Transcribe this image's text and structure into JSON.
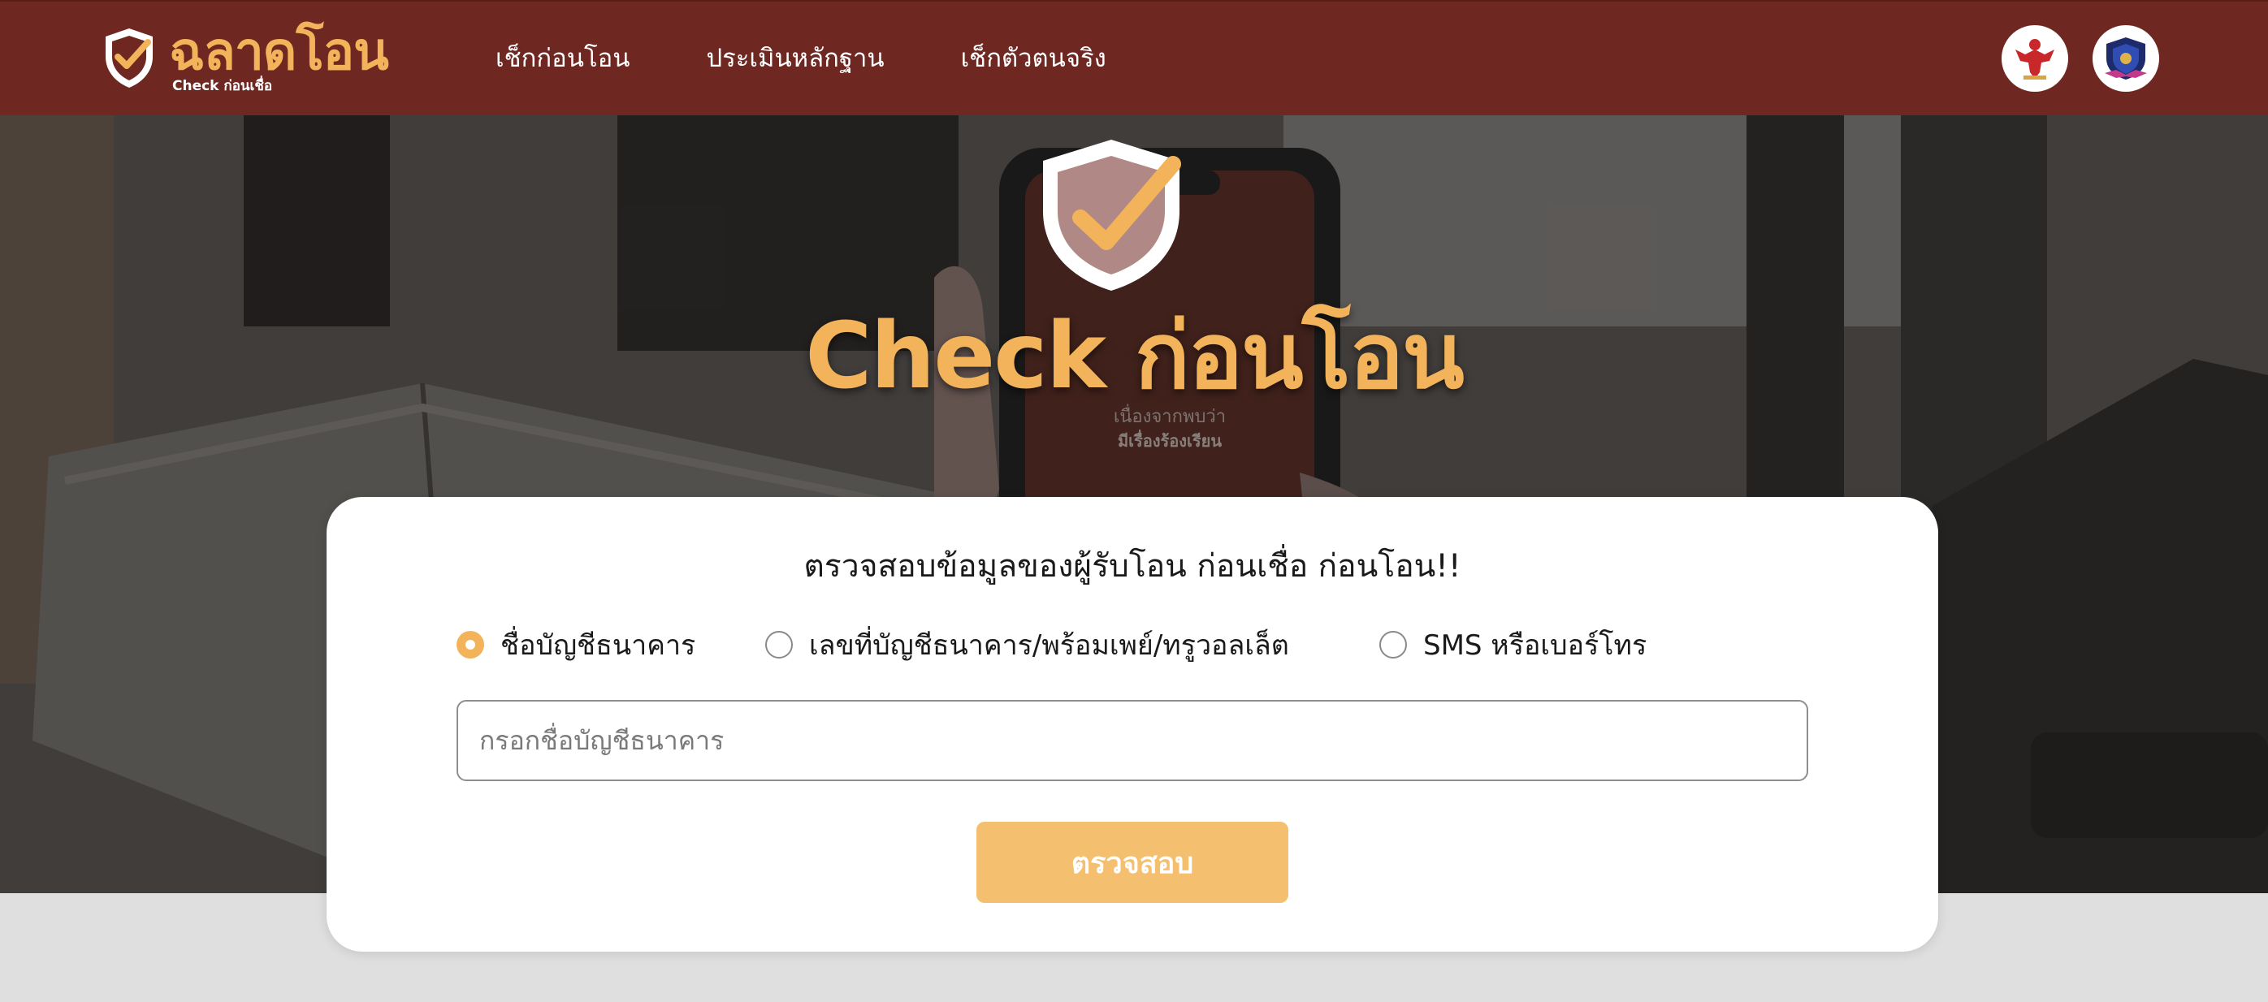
{
  "header": {
    "logo": {
      "title": "ฉลาดโอน",
      "subtitle": "Check ก่อนเชื่อ",
      "icon": "shield-check-icon"
    },
    "nav": [
      {
        "label": "เช็กก่อนโอน"
      },
      {
        "label": "ประเมินหลักฐาน"
      },
      {
        "label": "เช็กตัวตนจริง"
      }
    ],
    "badges": [
      {
        "icon": "garuda-emblem-icon"
      },
      {
        "icon": "police-emblem-icon"
      }
    ]
  },
  "hero": {
    "title": "Check ก่อนโอน",
    "icon": "shield-check-icon"
  },
  "form": {
    "heading": "ตรวจสอบข้อมูลของผู้รับโอน ก่อนเชื่อ ก่อนโอน!!",
    "options": [
      {
        "label": "ชื่อบัญชีธนาคาร",
        "checked": true
      },
      {
        "label": "เลขที่บัญชีธนาคาร/พร้อมเพย์/ทรูวอลเล็ต",
        "checked": false
      },
      {
        "label": "SMS หรือเบอร์โทร",
        "checked": false
      }
    ],
    "input": {
      "placeholder": "กรอกชื่อบัญชีธนาคาร",
      "value": ""
    },
    "submit_label": "ตรวจสอบ"
  },
  "colors": {
    "header_bg": "#6f2721",
    "accent": "#f2b35a",
    "button_bg": "#f4bf6e",
    "page_bg": "#dfdfdf"
  }
}
